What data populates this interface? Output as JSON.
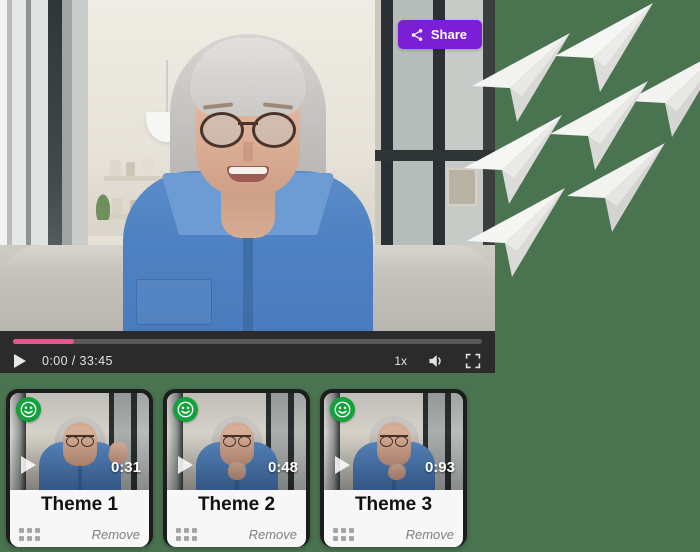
{
  "background_color": "#4a7350",
  "player": {
    "share_button": {
      "label": "Share",
      "icon": "share-icon",
      "color": "#7b1fd6"
    },
    "controls": {
      "play_icon": "play-icon",
      "time_label": "0:00 / 33:45",
      "current_time": "0:00",
      "duration": "33:45",
      "progress_percent": 13,
      "progress_color": "#e4578f",
      "speed_label": "1x",
      "volume_icon": "volume-icon",
      "fullscreen_icon": "fullscreen-icon"
    }
  },
  "theme_cards": [
    {
      "badge_icon": "smiley-face-icon",
      "badge_color": "#12a13c",
      "play_icon": "play-icon",
      "duration": "0:31",
      "title": "Theme 1",
      "drag_handle_icon": "drag-handle-icon",
      "remove_label": "Remove"
    },
    {
      "badge_icon": "smiley-face-icon",
      "badge_color": "#12a13c",
      "play_icon": "play-icon",
      "duration": "0:48",
      "title": "Theme 2",
      "drag_handle_icon": "drag-handle-icon",
      "remove_label": "Remove"
    },
    {
      "badge_icon": "smiley-face-icon",
      "badge_color": "#12a13c",
      "play_icon": "play-icon",
      "duration": "0:93",
      "title": "Theme 3",
      "drag_handle_icon": "drag-handle-icon",
      "remove_label": "Remove"
    }
  ],
  "decoration": {
    "planes_icon": "paper-plane-icon",
    "planes_count": 7
  }
}
